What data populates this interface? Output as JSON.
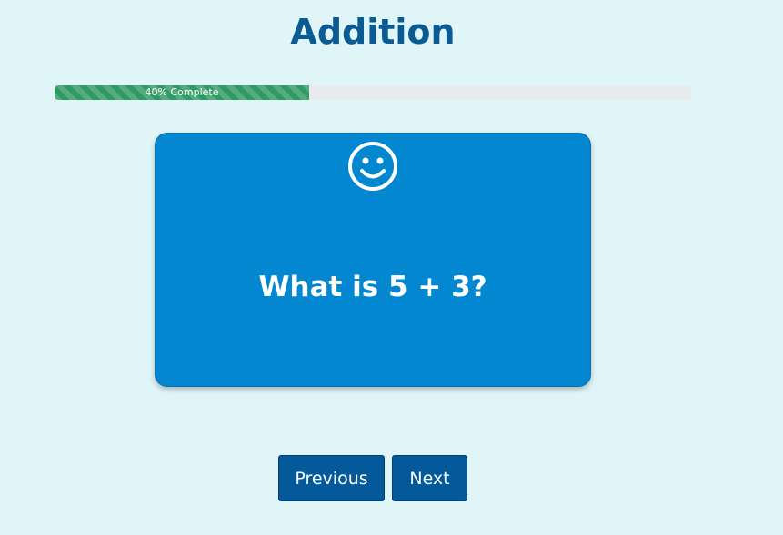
{
  "page": {
    "title": "Addition"
  },
  "progress": {
    "percent": 40,
    "label": "40% Complete",
    "fill_color": "#2e9a64"
  },
  "card": {
    "icon": "smiley-face-icon",
    "question": "What is 5 + 3?",
    "background_color": "#0287d0"
  },
  "navigation": {
    "previous_label": "Previous",
    "next_label": "Next",
    "button_color": "#04599a"
  }
}
